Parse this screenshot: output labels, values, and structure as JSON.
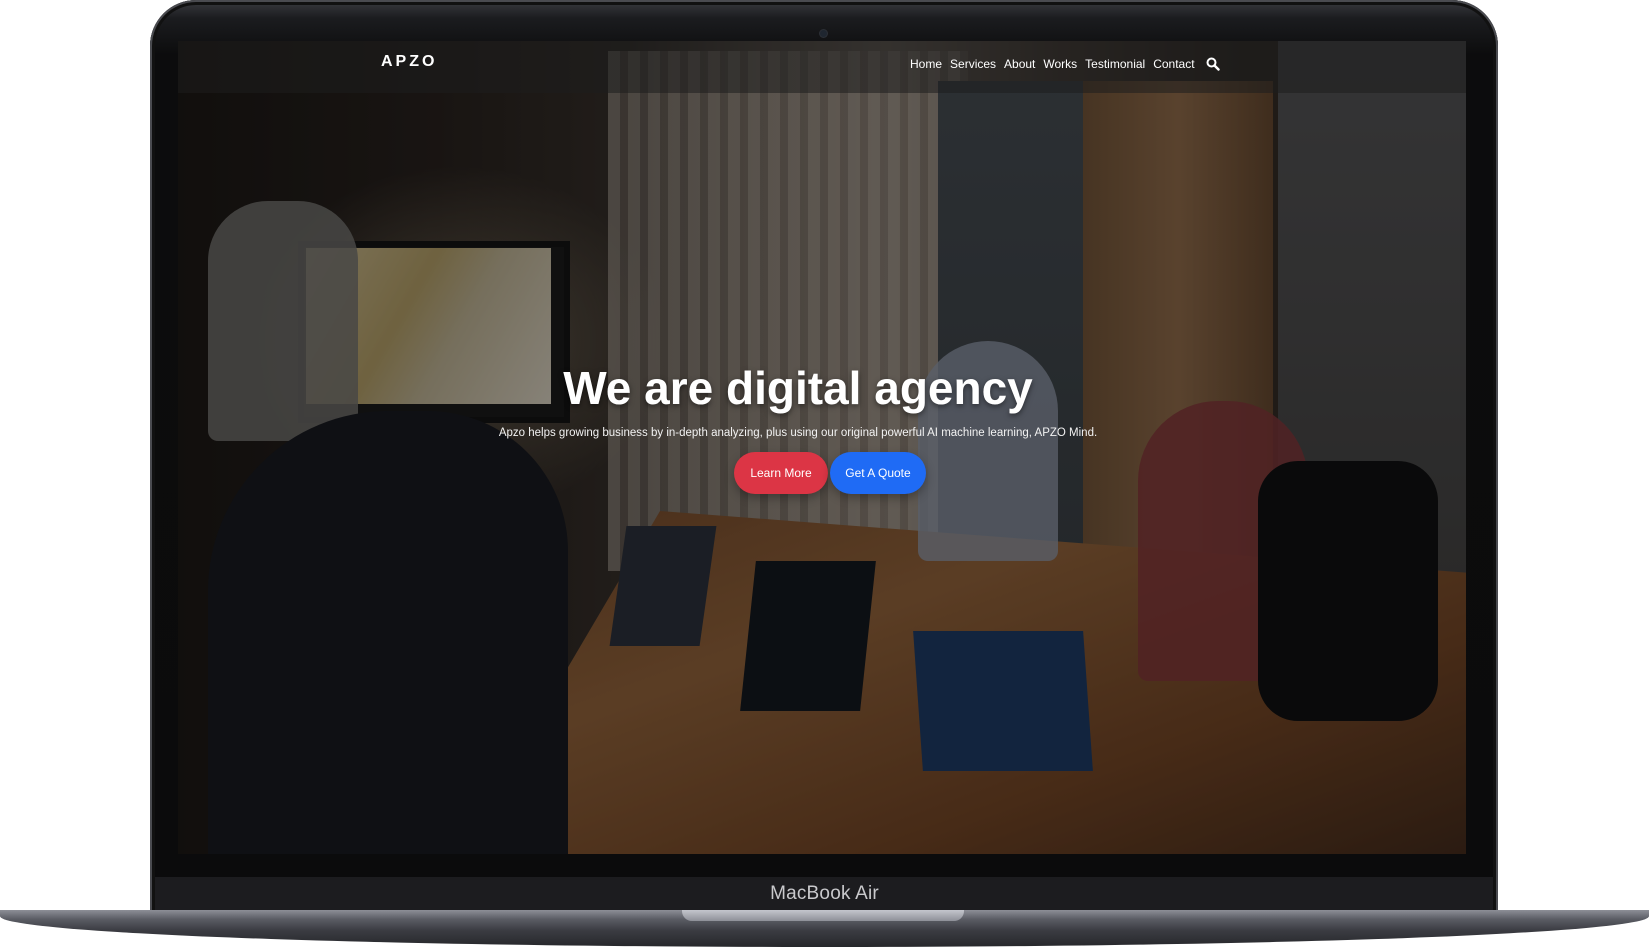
{
  "device": {
    "model_label": "MacBook Air"
  },
  "site": {
    "logo": "APZO",
    "nav": {
      "items": [
        "Home",
        "Services",
        "About",
        "Works",
        "Testimonial",
        "Contact"
      ],
      "search_icon": "search-icon"
    },
    "hero": {
      "title": "We are digital agency",
      "subtitle": "Apzo helps growing business by in-depth analyzing, plus using our original powerful AI machine learning, APZO Mind.",
      "primary_button": "Learn More",
      "secondary_button": "Get A Quote"
    }
  },
  "colors": {
    "primary_button": "#dc3545",
    "secondary_button": "#1f6bf5",
    "overlay": "rgba(0,0,0,0.42)",
    "text": "#ffffff"
  }
}
